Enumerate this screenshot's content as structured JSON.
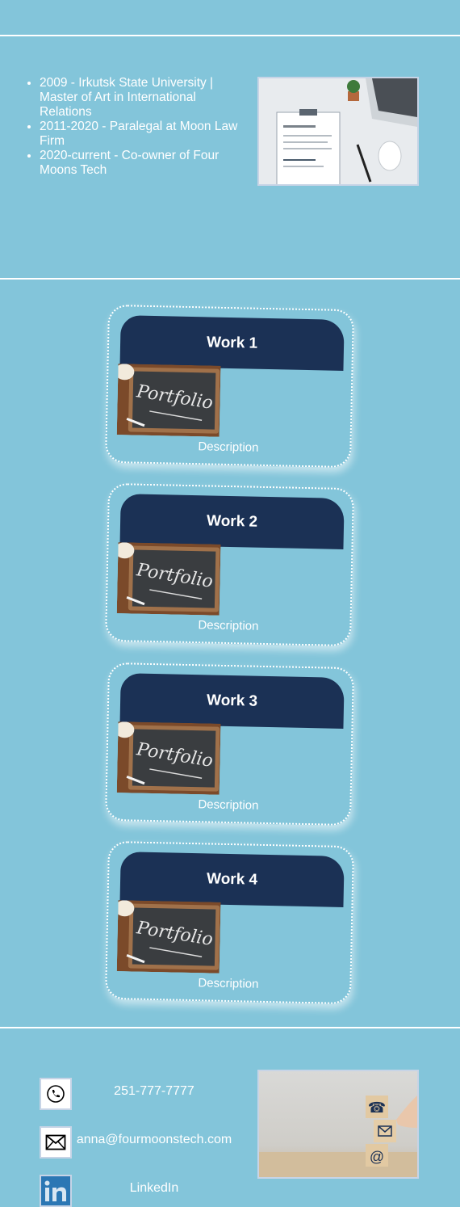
{
  "education": [
    "2009 - Irkutsk State University | Master of Art in International Relations",
    "2011-2020 - Paralegal at Moon Law Firm",
    "2020-current - Co-owner of Four Moons Tech"
  ],
  "works": [
    {
      "title": "Work 1",
      "image_text": "Portfolio",
      "description": "Description"
    },
    {
      "title": "Work 2",
      "image_text": "Portfolio",
      "description": "Description"
    },
    {
      "title": "Work 3",
      "image_text": "Portfolio",
      "description": "Description"
    },
    {
      "title": "Work 4",
      "image_text": "Portfolio",
      "description": "Description"
    }
  ],
  "contacts": {
    "phone": "251-777-7777",
    "email": "anna@fourmoonstech.com",
    "linkedin": "LinkedIn"
  },
  "colors": {
    "background": "#83c5da",
    "card_header": "#1b3155",
    "linkedin": "#2b77b4"
  },
  "icons": [
    "phone-icon",
    "envelope-icon",
    "linkedin-icon"
  ]
}
